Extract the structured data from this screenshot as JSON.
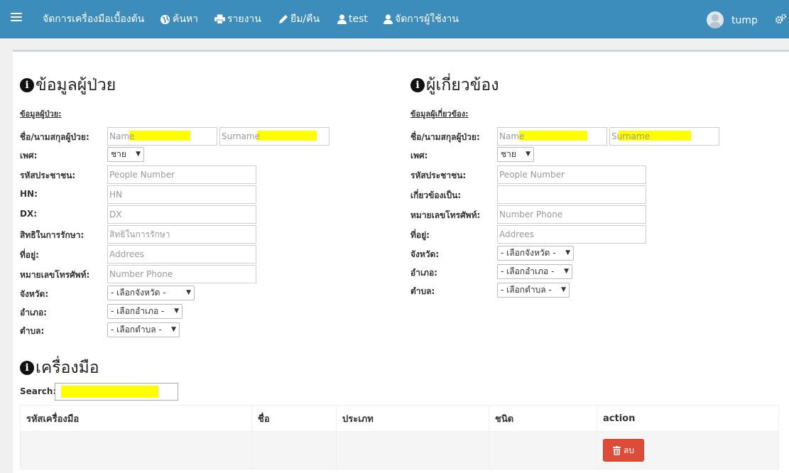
{
  "nav": {
    "items": [
      {
        "label": "จัดการเครื่องมือเบื้องต้น",
        "icon": "none"
      },
      {
        "label": "ค้นหา",
        "icon": "globe-icon"
      },
      {
        "label": "รายงาน",
        "icon": "printer-icon"
      },
      {
        "label": "ยืม/คืน",
        "icon": "pencil-icon"
      },
      {
        "label": "test",
        "icon": "user-icon"
      },
      {
        "label": "จัดการผู้ใช้งาน",
        "icon": "user-icon"
      }
    ],
    "user_name": "tump"
  },
  "patient": {
    "title": "ข้อมูลผู้ป่วย",
    "subtitle": "ข้อมูลผู้ป่วย:",
    "name_label": "ชื่อ/นามสกุลผู้ป่วย:",
    "first_placeholder": "Name",
    "last_placeholder": "Surname",
    "gender_label": "เพศ:",
    "gender_value": "ชาย",
    "id_label": "รหัสประชาชน:",
    "id_placeholder": "People Number",
    "hn_label": "HN:",
    "hn_placeholder": "HN",
    "dx_label": "DX:",
    "dx_placeholder": "DX",
    "rights_label": "สิทธิในการรักษา:",
    "rights_placeholder": "สิทธิในการรักษา",
    "address_label": "ที่อยู่:",
    "address_placeholder": "Addrees",
    "phone_label": "หมายเลขโทรศัพท์:",
    "phone_placeholder": "Number Phone",
    "province_label": "จังหวัด:",
    "province_value": "- เลือกจังหวัด -",
    "district_label": "อำเภอ:",
    "district_value": "- เลือกอำเภอ -",
    "subdistrict_label": "ตำบล:",
    "subdistrict_value": "- เลือกตำบล -"
  },
  "relative": {
    "title": "ผู้เกี่ยวข้อง",
    "subtitle": "ข้อมูลผู้เกี่ยวข้อง:",
    "name_label": "ชื่อ/นามสกุลผู้ป่วย:",
    "first_placeholder": "Name",
    "last_placeholder": "Surname",
    "gender_label": "เพศ:",
    "gender_value": "ชาย",
    "id_label": "รหัสประชาชน:",
    "id_placeholder": "People Number",
    "relation_label": "เกี่ยวข้องเป็น:",
    "relation_placeholder": "",
    "phone_label": "หมายเลขโทรศัพท์:",
    "phone_placeholder": "Number Phone",
    "address_label": "ที่อยู่:",
    "address_placeholder": "Addrees",
    "province_label": "จังหวัด:",
    "province_value": "- เลือกจังหวัด -",
    "district_label": "อำเภอ:",
    "district_value": "- เลือกอำเภอ -",
    "subdistrict_label": "ตำบล:",
    "subdistrict_value": "- เลือกตำบล -"
  },
  "tools": {
    "title": "เครื่องมือ",
    "search_label": "Search:",
    "columns": [
      "รหัสเครื่องมือ",
      "ชื่อ",
      "ประเภท",
      "ชนิด",
      "action"
    ],
    "delete_label": "ลบ"
  },
  "colors": {
    "navbar": "#3c8dbc",
    "danger": "#dd4b39",
    "highlight": "#ffff00"
  }
}
